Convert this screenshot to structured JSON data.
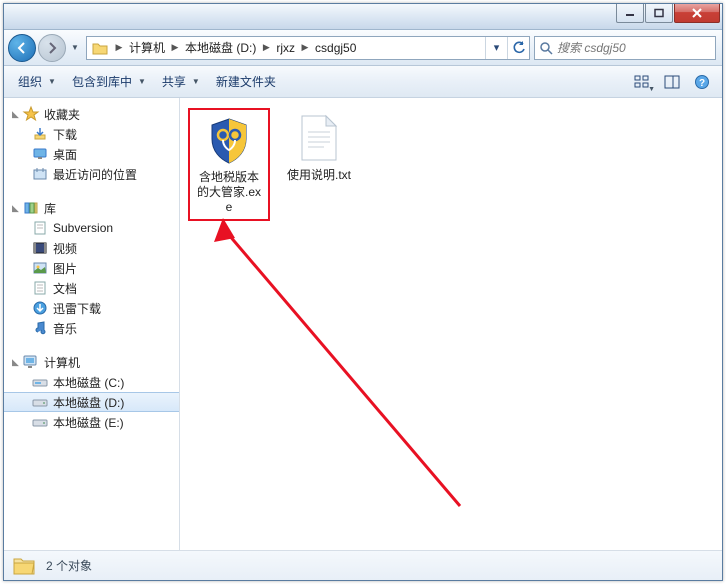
{
  "nav": {
    "crumbs": [
      "计算机",
      "本地磁盘 (D:)",
      "rjxz",
      "csdgj50"
    ]
  },
  "search": {
    "placeholder": "搜索 csdgj50"
  },
  "toolbar": {
    "organize": "组织",
    "include": "包含到库中",
    "share": "共享",
    "newfolder": "新建文件夹"
  },
  "sidebar": {
    "favorites": {
      "label": "收藏夹",
      "items": [
        "下载",
        "桌面",
        "最近访问的位置"
      ]
    },
    "libraries": {
      "label": "库",
      "items": [
        "Subversion",
        "视频",
        "图片",
        "文档",
        "迅雷下载",
        "音乐"
      ]
    },
    "computer": {
      "label": "计算机",
      "items": [
        "本地磁盘 (C:)",
        "本地磁盘 (D:)",
        "本地磁盘 (E:)"
      ],
      "selected": 1
    }
  },
  "files": [
    {
      "name": "含地税版本的大管家.exe",
      "kind": "shield-exe",
      "highlight": true
    },
    {
      "name": "使用说明.txt",
      "kind": "txt",
      "highlight": false
    }
  ],
  "status": {
    "count_label": "2 个对象"
  }
}
